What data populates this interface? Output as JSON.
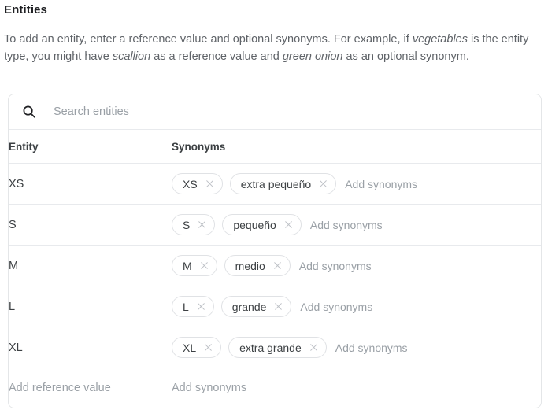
{
  "header": {
    "title": "Entities",
    "intro": {
      "seg1": "To add an entity, enter a reference value and optional synonyms. For example, if ",
      "em1": "vegetables",
      "seg2": " is the entity type, you might have ",
      "em2": "scallion",
      "seg3": " as a reference value and ",
      "em3": "green onion",
      "seg4": " as an optional synonym."
    }
  },
  "search": {
    "icon": "search-icon",
    "value": "",
    "placeholder": "Search entities"
  },
  "table": {
    "columns": {
      "entity": "Entity",
      "synonyms": "Synonyms"
    },
    "add_synonyms_placeholder": "Add synonyms",
    "rows": [
      {
        "entity": "XS",
        "synonyms": [
          {
            "label": "XS",
            "remove_icon": "close-icon"
          },
          {
            "label": "extra pequeño",
            "remove_icon": "close-icon"
          }
        ]
      },
      {
        "entity": "S",
        "synonyms": [
          {
            "label": "S",
            "remove_icon": "close-icon"
          },
          {
            "label": "pequeño",
            "remove_icon": "close-icon"
          }
        ]
      },
      {
        "entity": "M",
        "synonyms": [
          {
            "label": "M",
            "remove_icon": "close-icon"
          },
          {
            "label": "medio",
            "remove_icon": "close-icon"
          }
        ]
      },
      {
        "entity": "L",
        "synonyms": [
          {
            "label": "L",
            "remove_icon": "close-icon"
          },
          {
            "label": "grande",
            "remove_icon": "close-icon"
          }
        ]
      },
      {
        "entity": "XL",
        "synonyms": [
          {
            "label": "XL",
            "remove_icon": "close-icon"
          },
          {
            "label": "extra grande",
            "remove_icon": "close-icon"
          }
        ]
      }
    ],
    "add_row": {
      "reference_placeholder": "Add reference value",
      "synonyms_placeholder": "Add synonyms"
    }
  },
  "colors": {
    "text_primary": "#3c4043",
    "text_secondary": "#5f6368",
    "text_placeholder": "#9aa0a6",
    "border": "#e8eaed",
    "card_border": "#e4e6e8",
    "background": "#ffffff"
  }
}
